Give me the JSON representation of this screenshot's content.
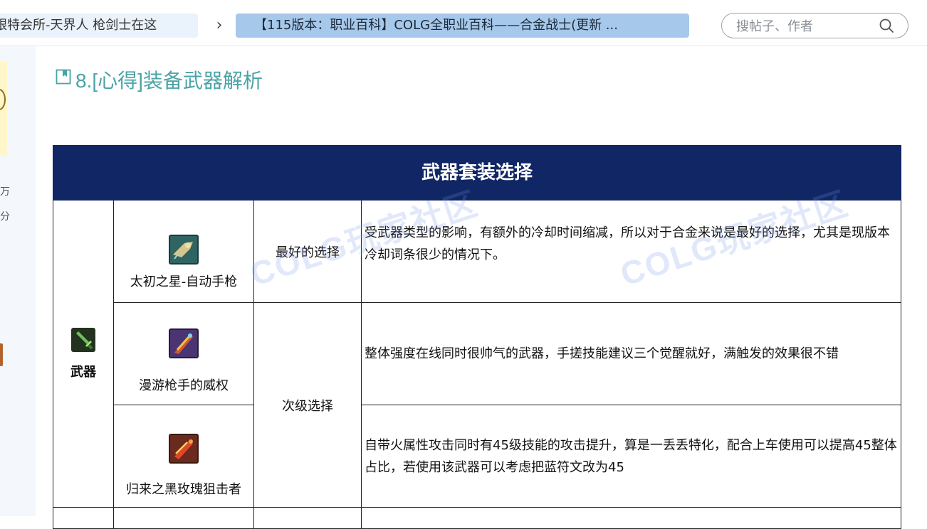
{
  "nav": {
    "crumb_forum": "银特会所-天界人 枪剑士在这",
    "crumb_thread": "【115版本：职业百科】COLG全职业百科——合金战士(更新 ...",
    "search_placeholder": "搜帖子、作者"
  },
  "rail": {
    "text1": "万",
    "text2": "分"
  },
  "section": {
    "title": "8.[心得]装备武器解析"
  },
  "table": {
    "header": "武器套装选择",
    "category_label": "武器",
    "rows": [
      {
        "name": "太初之星-自动手枪",
        "choice": "最好的选择",
        "desc": "受武器类型的影响，有额外的冷却时间缩减，所以对于合金来说是最好的选择，尤其是现版本冷却词条很少的情况下。"
      },
      {
        "name": "漫游枪手的威权",
        "choice": "次级选择",
        "desc": "整体强度在线同时很帅气的武器，手搓技能建议三个觉醒就好，满触发的效果很不错"
      },
      {
        "name": "归来之黑玫瑰狙击者",
        "choice": "",
        "desc": "自带火属性攻击同时有45级技能的攻击提升，算是一丢丢特化，配合上车使用可以提高45整体占比，若使用该武器可以考虑把蓝符文改为45"
      }
    ]
  },
  "watermark": {
    "text": "COLG玩家社区"
  },
  "colors": {
    "header_bg": "#102665",
    "heading_text": "#4aa3a6",
    "crumb_active": "#a6c8ea"
  }
}
